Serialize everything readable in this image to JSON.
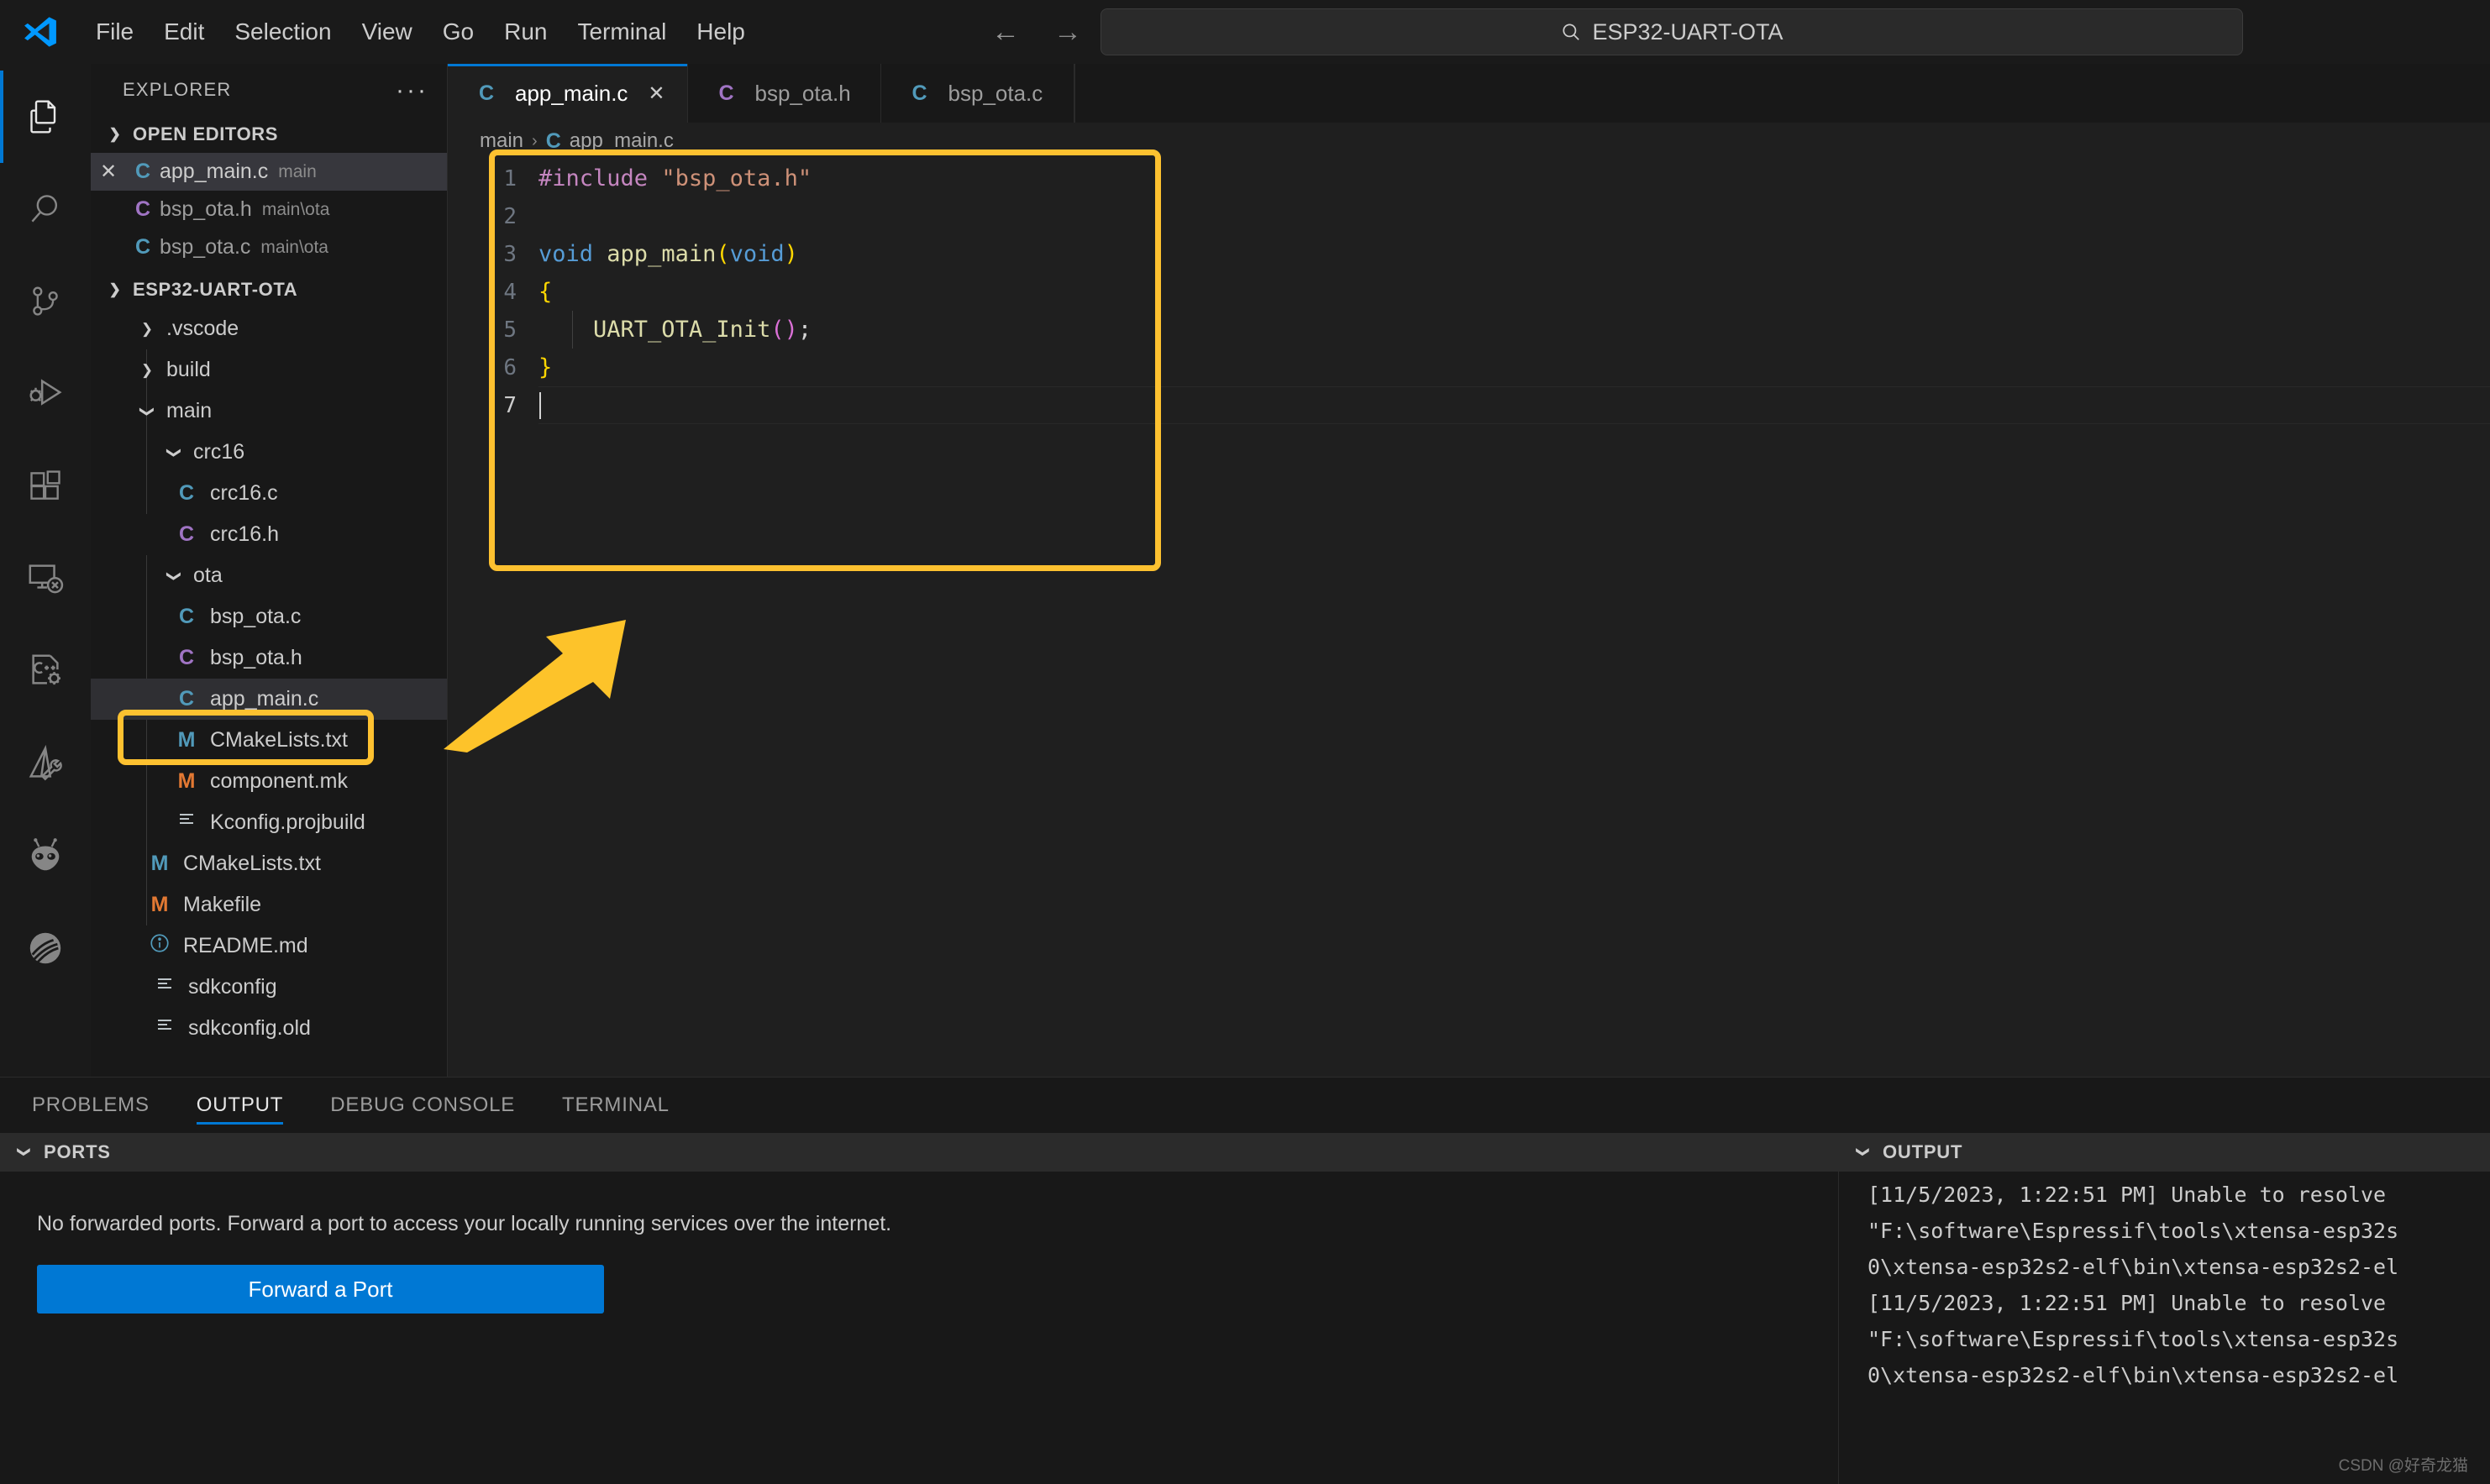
{
  "window": {
    "quick_input_text": "ESP32-UART-OTA",
    "search_icon": "search-icon",
    "back_arrow": "←",
    "forward_arrow": "→"
  },
  "menubar": {
    "items": [
      "File",
      "Edit",
      "Selection",
      "View",
      "Go",
      "Run",
      "Terminal",
      "Help"
    ]
  },
  "activity_bar": {
    "items": [
      {
        "name": "explorer-icon",
        "active": true
      },
      {
        "name": "search-icon",
        "active": false
      },
      {
        "name": "source-control-icon",
        "active": false
      },
      {
        "name": "run-and-debug-icon",
        "active": false
      },
      {
        "name": "extensions-icon",
        "active": false
      },
      {
        "name": "remote-explorer-icon",
        "active": false
      },
      {
        "name": "cpp-config-icon",
        "active": false
      },
      {
        "name": "cmake-tools-icon",
        "active": false
      },
      {
        "name": "platformio-icon",
        "active": false
      },
      {
        "name": "espressif-idf-icon",
        "active": false
      }
    ]
  },
  "sidebar": {
    "title": "EXPLORER",
    "more_actions": "···",
    "open_editors": {
      "label": "OPEN EDITORS",
      "expanded": true,
      "items": [
        {
          "icon": "c-file-icon",
          "icon_kind": "c",
          "name": "app_main.c",
          "desc": "main",
          "selected": true,
          "closable": true
        },
        {
          "icon": "c-header-file-icon",
          "icon_kind": "h",
          "name": "bsp_ota.h",
          "desc": "main\\ota",
          "selected": false,
          "closable": false
        },
        {
          "icon": "c-file-icon",
          "icon_kind": "c",
          "name": "bsp_ota.c",
          "desc": "main\\ota",
          "selected": false,
          "closable": false
        }
      ]
    },
    "project": {
      "label": "ESP32-UART-OTA",
      "expanded": true,
      "tree": [
        {
          "depth": 1,
          "kind": "folder",
          "twisty": "collapsed",
          "name": ".vscode"
        },
        {
          "depth": 1,
          "kind": "folder",
          "twisty": "collapsed",
          "name": "build"
        },
        {
          "depth": 1,
          "kind": "folder",
          "twisty": "expanded",
          "name": "main"
        },
        {
          "depth": 2,
          "kind": "folder",
          "twisty": "expanded",
          "name": "crc16"
        },
        {
          "depth": 3,
          "kind": "file",
          "icon_kind": "c",
          "name": "crc16.c"
        },
        {
          "depth": 3,
          "kind": "file",
          "icon_kind": "h",
          "name": "crc16.h"
        },
        {
          "depth": 2,
          "kind": "folder",
          "twisty": "expanded",
          "name": "ota"
        },
        {
          "depth": 3,
          "kind": "file",
          "icon_kind": "c",
          "name": "bsp_ota.c"
        },
        {
          "depth": 3,
          "kind": "file",
          "icon_kind": "h",
          "name": "bsp_ota.h"
        },
        {
          "depth": 3,
          "kind": "file",
          "icon_kind": "c",
          "name": "app_main.c",
          "highlighted": true
        },
        {
          "depth": 3,
          "kind": "file",
          "icon_kind": "m",
          "name": "CMakeLists.txt"
        },
        {
          "depth": 3,
          "kind": "file",
          "icon_kind": "mk",
          "name": "component.mk"
        },
        {
          "depth": 3,
          "kind": "file",
          "icon_kind": "txt",
          "name": "Kconfig.projbuild"
        },
        {
          "depth": 1,
          "kind": "file",
          "icon_kind": "m",
          "name": "CMakeLists.txt"
        },
        {
          "depth": 1,
          "kind": "file",
          "icon_kind": "mk",
          "name": "Makefile"
        },
        {
          "depth": 1,
          "kind": "file",
          "icon_kind": "info",
          "name": "README.md"
        },
        {
          "depth": 1,
          "kind": "file",
          "icon_kind": "txt",
          "name": "sdkconfig"
        },
        {
          "depth": 1,
          "kind": "file",
          "icon_kind": "txt",
          "name": "sdkconfig.old"
        }
      ]
    }
  },
  "editor": {
    "tabs": [
      {
        "icon_kind": "c",
        "label": "app_main.c",
        "active": true,
        "close": "✕"
      },
      {
        "icon_kind": "h",
        "label": "bsp_ota.h",
        "active": false
      },
      {
        "icon_kind": "c",
        "label": "bsp_ota.c",
        "active": false
      }
    ],
    "breadcrumb": {
      "folder": "main",
      "separator": "›",
      "file": "app_main.c"
    },
    "line_numbers": [
      "1",
      "2",
      "3",
      "4",
      "5",
      "6",
      "7"
    ],
    "code": {
      "line1_directive": "#include",
      "line1_string": "\"bsp_ota.h\"",
      "line3_kw": "void",
      "line3_fn": "app_main",
      "line3_open": "(",
      "line3_arg": "void",
      "line3_close": ")",
      "line4_brace": "{",
      "line5_call": "UART_OTA_Init",
      "line5_parens": "()",
      "line5_semi": ";",
      "line6_brace": "}"
    }
  },
  "panel": {
    "tabs": [
      {
        "label": "PROBLEMS",
        "active": false
      },
      {
        "label": "OUTPUT",
        "active": true
      },
      {
        "label": "DEBUG CONSOLE",
        "active": false
      },
      {
        "label": "TERMINAL",
        "active": false
      }
    ],
    "ports": {
      "section_title": "PORTS",
      "empty_message": "No forwarded ports. Forward a port to access your locally running services over the internet.",
      "button_label": "Forward a Port"
    },
    "output": {
      "section_title": "OUTPUT",
      "lines": [
        "[11/5/2023, 1:22:51 PM] Unable to resolve",
        "\"F:\\software\\Espressif\\tools\\xtensa-esp32s",
        "0\\xtensa-esp32s2-elf\\bin\\xtensa-esp32s2-el",
        "[11/5/2023, 1:22:51 PM] Unable to resolve",
        "\"F:\\software\\Espressif\\tools\\xtensa-esp32s",
        "0\\xtensa-esp32s2-elf\\bin\\xtensa-esp32s2-el"
      ]
    }
  },
  "annotations": {
    "highlight_color": "#fdc130",
    "rect_editor": "code-region-highlight",
    "rect_file": "app-main-file-highlight",
    "arrow": "pointer-arrow"
  },
  "watermark": {
    "text": "CSDN @好奇龙猫"
  }
}
